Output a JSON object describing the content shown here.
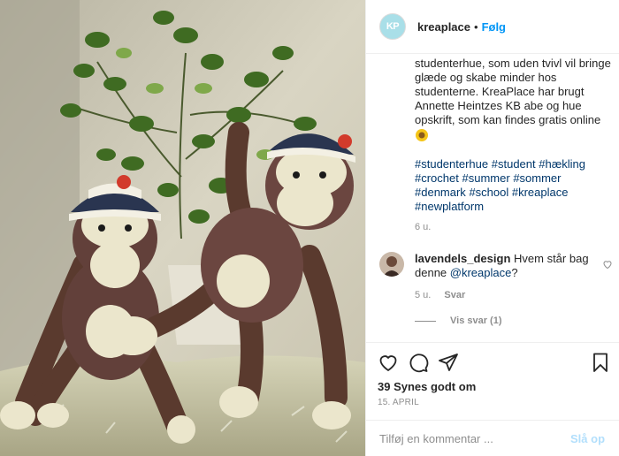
{
  "header": {
    "avatar_initials": "KP",
    "username": "kreaplace",
    "separator": "•",
    "follow_label": "Følg",
    "avatar_color": "#a9dfe8",
    "follow_color": "#0095f6"
  },
  "caption": {
    "text": "at hækle KB aber med en fin studenterhue, som uden tvivl vil bringe glæde og skabe minder hos studenterne. KreaPlace har brugt Annette Heintzes KB abe og hue opskrift, som kan findes gratis online",
    "emoji_icon": "sunflower-icon",
    "hashtags": [
      "#studenterhue",
      "#student",
      "#hækling",
      "#crochet",
      "#summer",
      "#sommer",
      "#denmark",
      "#school",
      "#kreaplace",
      "#newplatform"
    ],
    "time": "6 u."
  },
  "comment": {
    "username": "lavendels_design",
    "text": "Hvem står bag denne",
    "mention": "@kreaplace",
    "suffix": "?",
    "time": "5 u.",
    "reply_label": "Svar",
    "view_replies_label": "Vis svar (1)"
  },
  "actions": {
    "likes": "39 Synes godt om",
    "date": "15. APRIL",
    "icons": [
      "heart-icon",
      "comment-icon",
      "share-icon",
      "bookmark-icon"
    ]
  },
  "comment_box": {
    "placeholder": "Tilføj en kommentar ...",
    "post_label": "Slå op",
    "post_color": "#b2dffc"
  }
}
